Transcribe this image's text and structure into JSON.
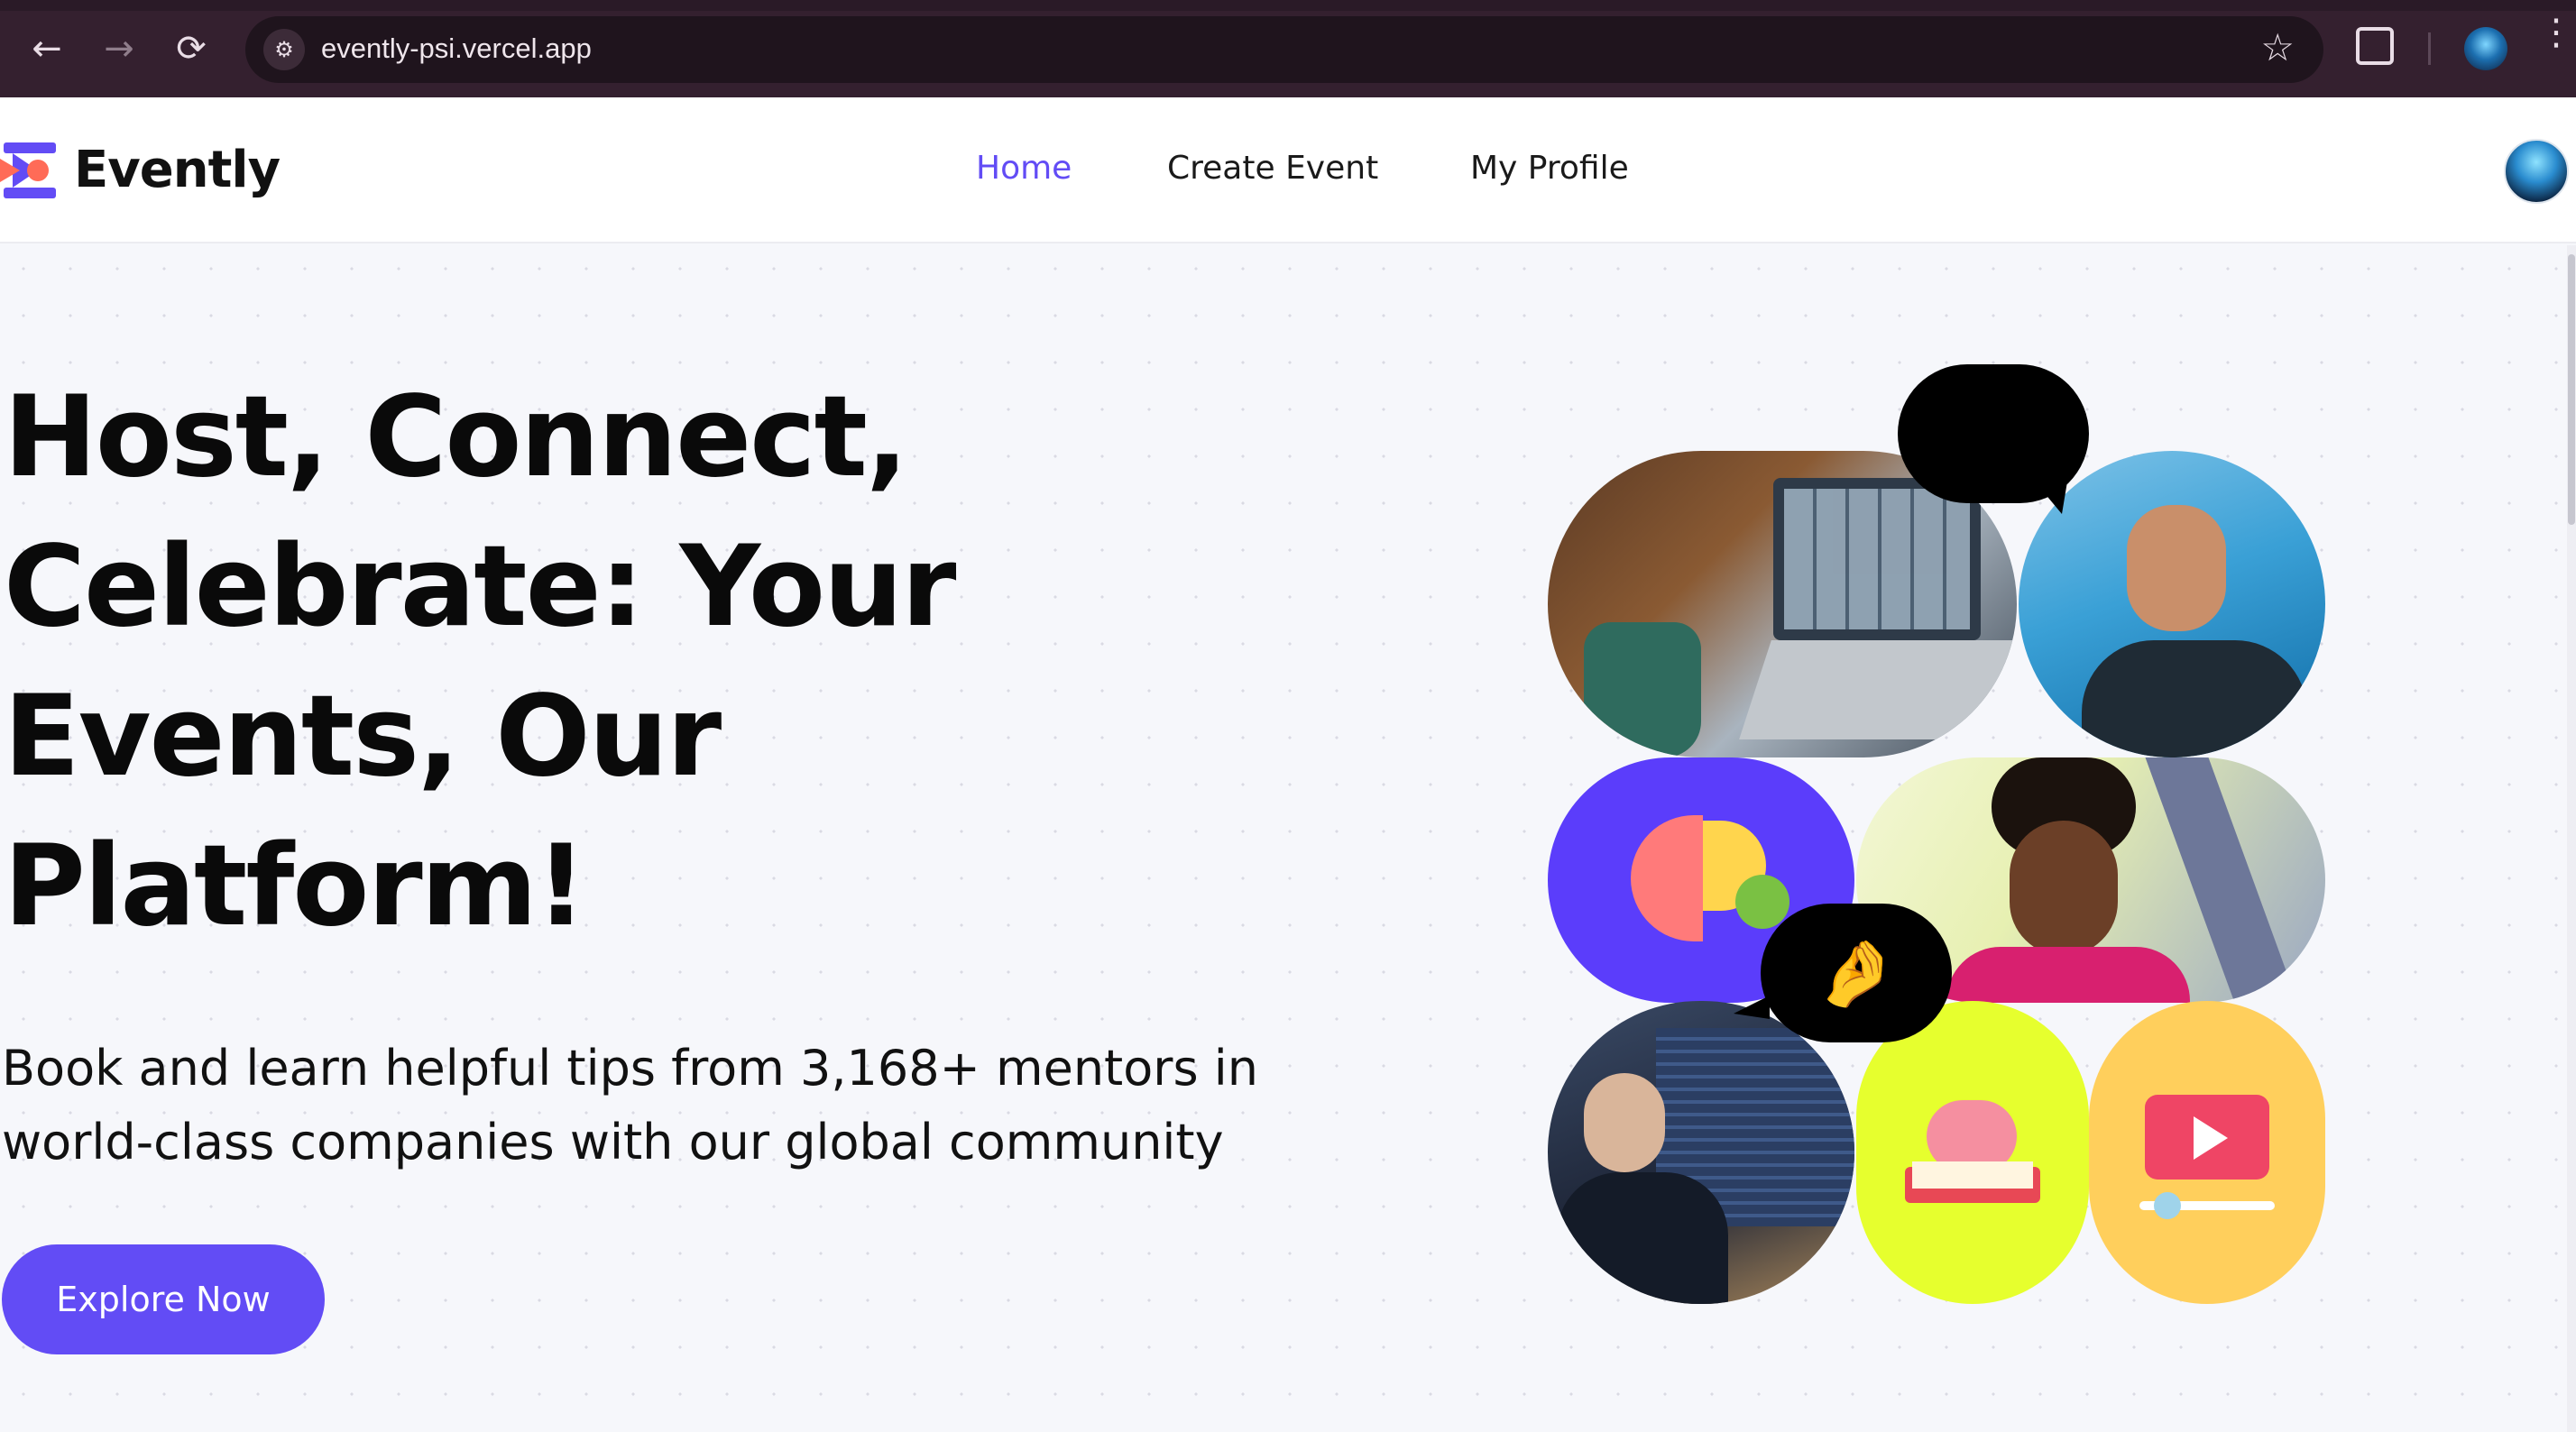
{
  "browser": {
    "url": "evently-psi.vercel.app",
    "back_icon": "←",
    "forward_icon": "→",
    "reload_icon": "⟳",
    "star_icon": "☆",
    "menu_icon": "⋮"
  },
  "header": {
    "logo_text": "Evently",
    "nav": [
      {
        "label": "Home",
        "active": true
      },
      {
        "label": "Create Event",
        "active": false
      },
      {
        "label": "My Profile",
        "active": false
      }
    ]
  },
  "hero": {
    "title_lines": [
      "Host, Connect,",
      "Celebrate: Your",
      "Events, Our",
      "Platform!"
    ],
    "subtitle_lines": [
      "Book and learn helpful tips from 3,168+ mentors in",
      "world-class companies with our global community"
    ],
    "cta_label": "Explore Now"
  },
  "collage": {
    "bubble_top_emoji": "😍",
    "bubble_bottom_emoji": "🤌"
  },
  "colors": {
    "accent": "#624cf5",
    "browser_frame": "#34202f",
    "purple_tile": "#5b3dfb",
    "lime_tile": "#e6ff2e",
    "yellow_tile": "#ffcf5c"
  }
}
